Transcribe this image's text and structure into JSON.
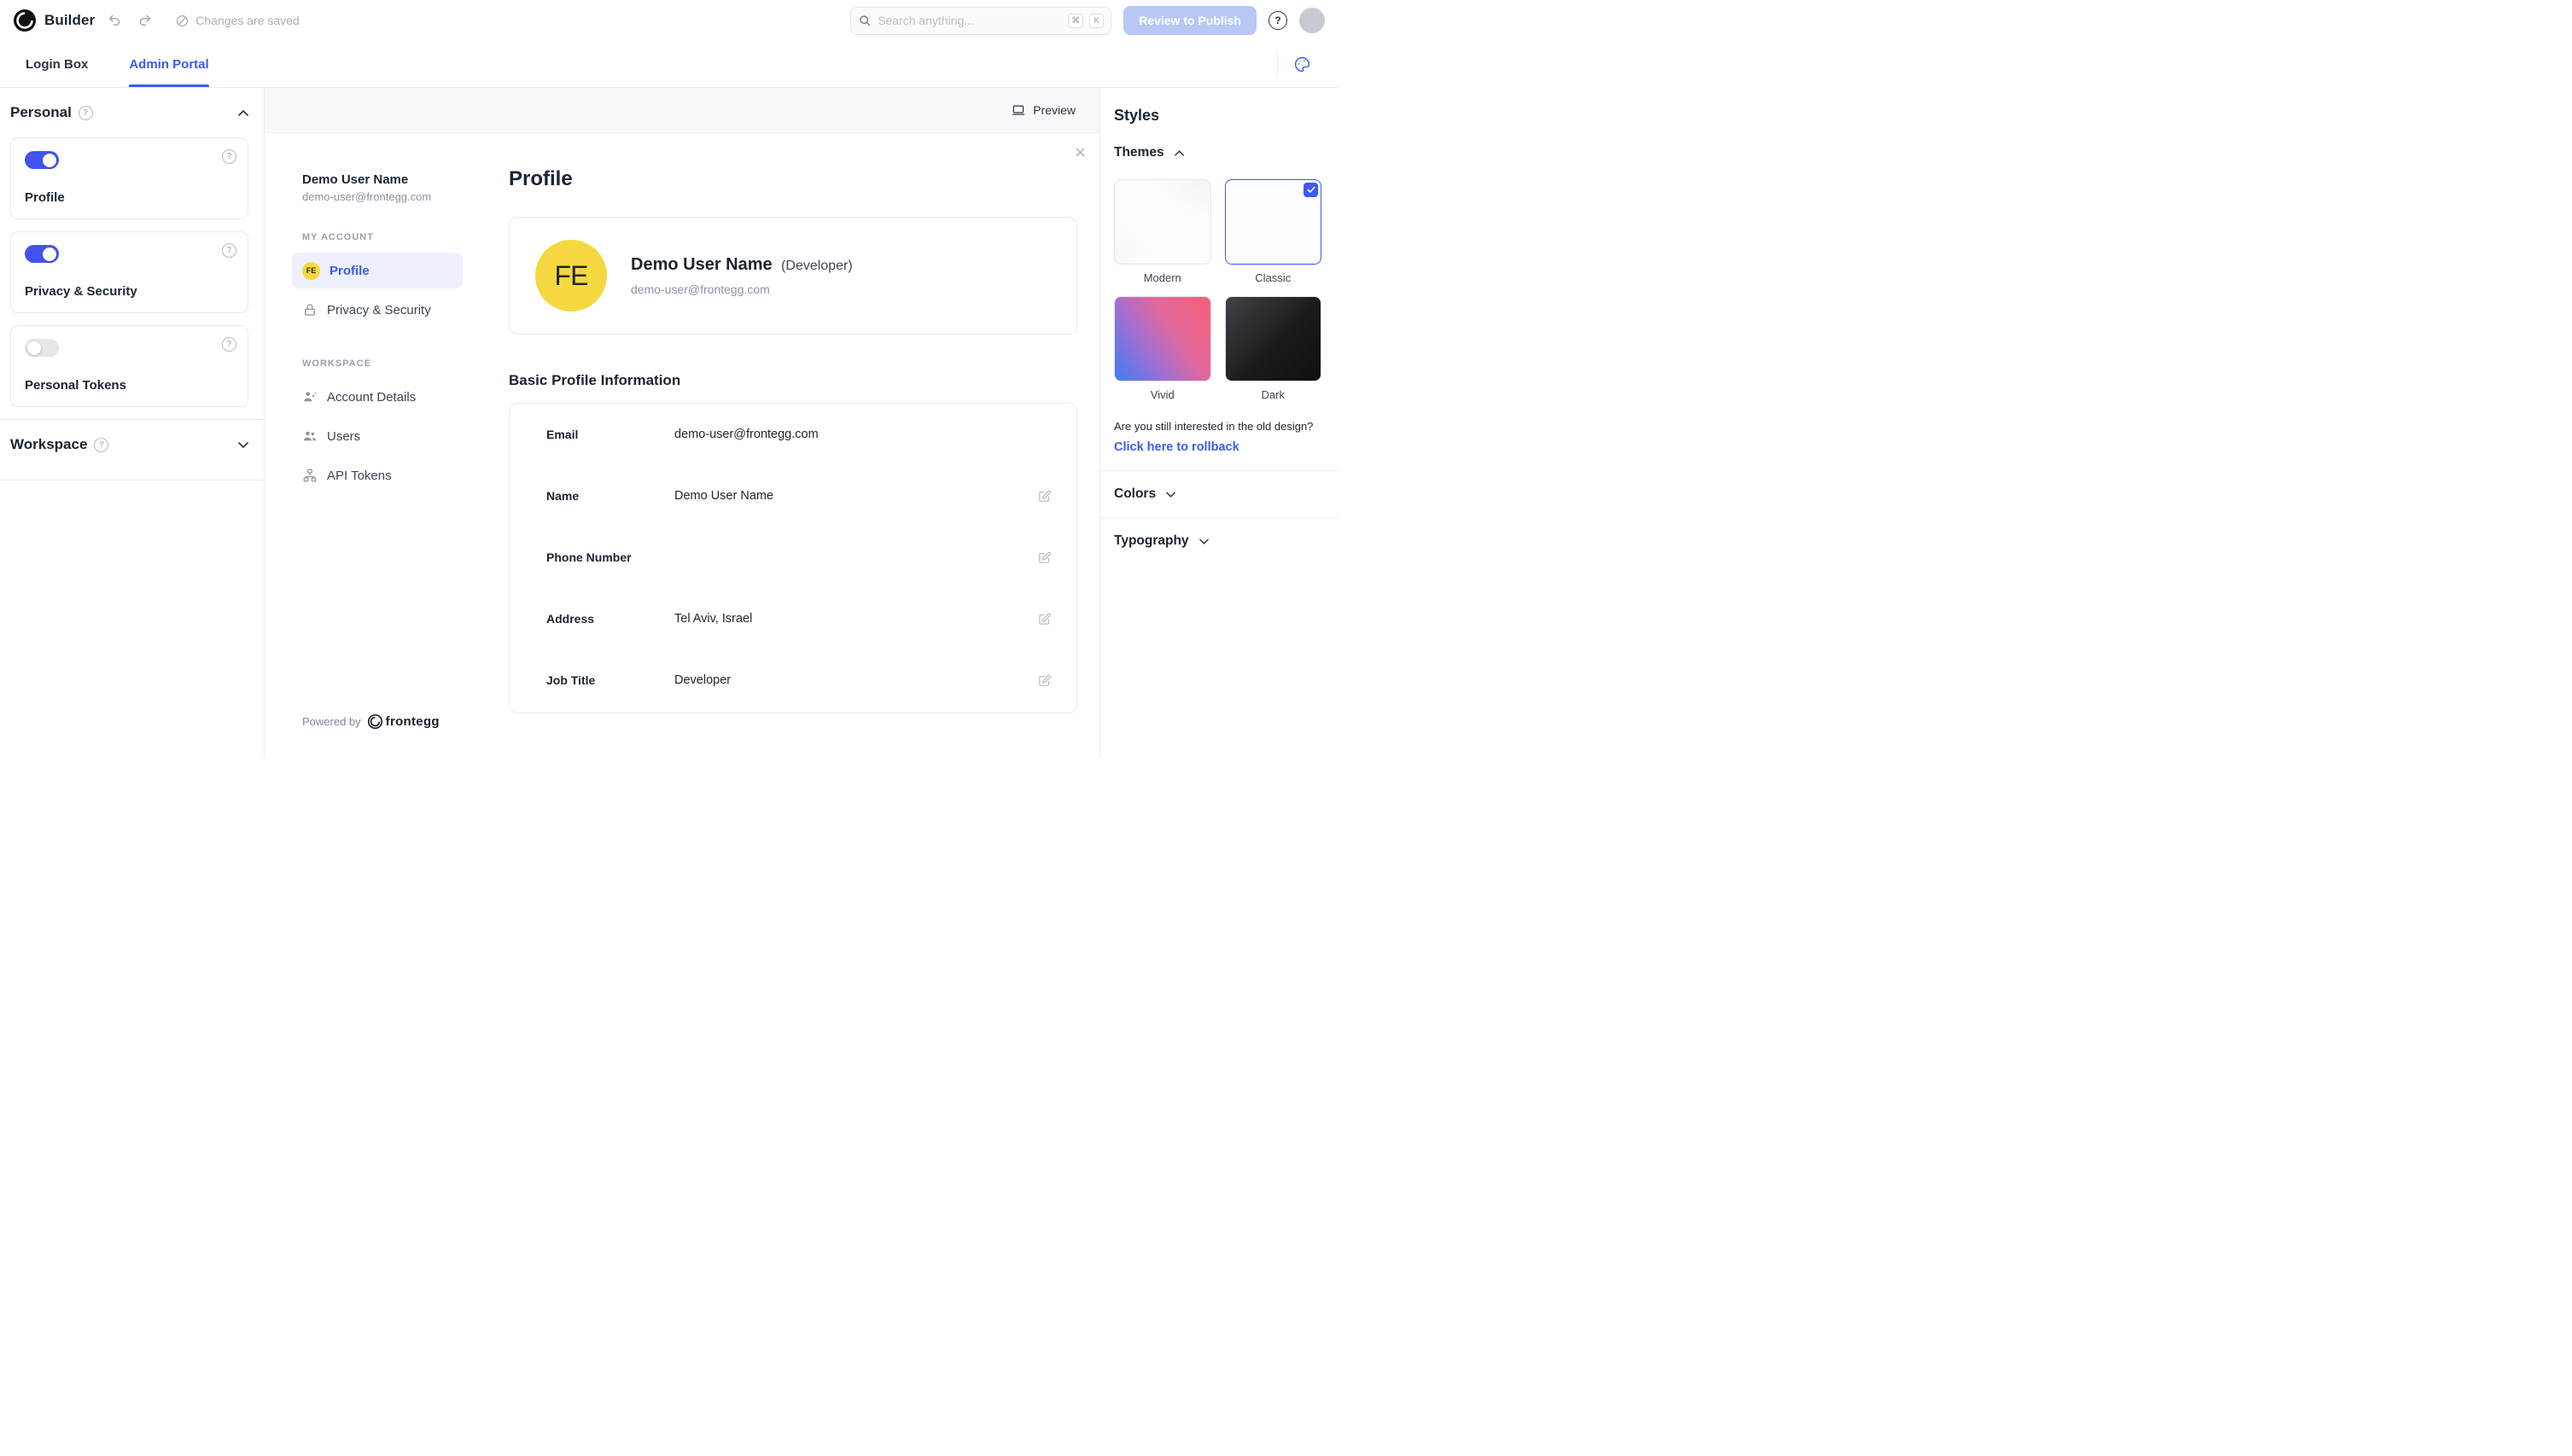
{
  "colors": {
    "accent": "#3d5af1",
    "toggle-on": "#4353ef",
    "publish": "#b7c8f4",
    "yellow": "#f5d83f"
  },
  "header": {
    "app_title": "Builder",
    "status_text": "Changes are saved",
    "search": {
      "placeholder": "Search anything...",
      "shortcut_mod": "⌘",
      "shortcut_key": "K"
    },
    "publish_label": "Review to Publish"
  },
  "tabs": [
    {
      "label": "Login Box"
    },
    {
      "label": "Admin Portal"
    }
  ],
  "sidebar": {
    "personal_title": "Personal",
    "cards": [
      {
        "label": "Profile",
        "enabled": true
      },
      {
        "label": "Privacy & Security",
        "enabled": true
      },
      {
        "label": "Personal Tokens",
        "enabled": false
      }
    ],
    "workspace_title": "Workspace"
  },
  "preview": {
    "toolbar_label": "Preview",
    "user": {
      "name": "Demo User Name",
      "email": "demo-user@frontegg.com",
      "initials": "FE"
    },
    "nav": {
      "my_account_title": "MY ACCOUNT",
      "my_account_items": [
        {
          "label": "Profile"
        },
        {
          "label": "Privacy & Security"
        }
      ],
      "workspace_title": "WORKSPACE",
      "workspace_items": [
        {
          "label": "Account Details"
        },
        {
          "label": "Users"
        },
        {
          "label": "API Tokens"
        }
      ]
    },
    "powered_by": "Powered by",
    "brand": "frontegg",
    "content": {
      "title": "Profile",
      "user_name": "Demo User Name",
      "user_role": "(Developer)",
      "user_email": "demo-user@frontegg.com",
      "section_title": "Basic Profile Information",
      "fields": [
        {
          "label": "Email",
          "value": "demo-user@frontegg.com"
        },
        {
          "label": "Name",
          "value": "Demo User Name"
        },
        {
          "label": "Phone Number",
          "value": ""
        },
        {
          "label": "Address",
          "value": "Tel Aviv, Israel"
        },
        {
          "label": "Job Title",
          "value": "Developer"
        }
      ]
    }
  },
  "styles_panel": {
    "title": "Styles",
    "themes_title": "Themes",
    "themes": [
      {
        "label": "Modern"
      },
      {
        "label": "Classic"
      },
      {
        "label": "Vivid"
      },
      {
        "label": "Dark"
      }
    ],
    "rollback_question": "Are you still interested in the old design?",
    "rollback_link": "Click here to rollback",
    "sections": [
      {
        "label": "Colors"
      },
      {
        "label": "Typography"
      }
    ]
  }
}
